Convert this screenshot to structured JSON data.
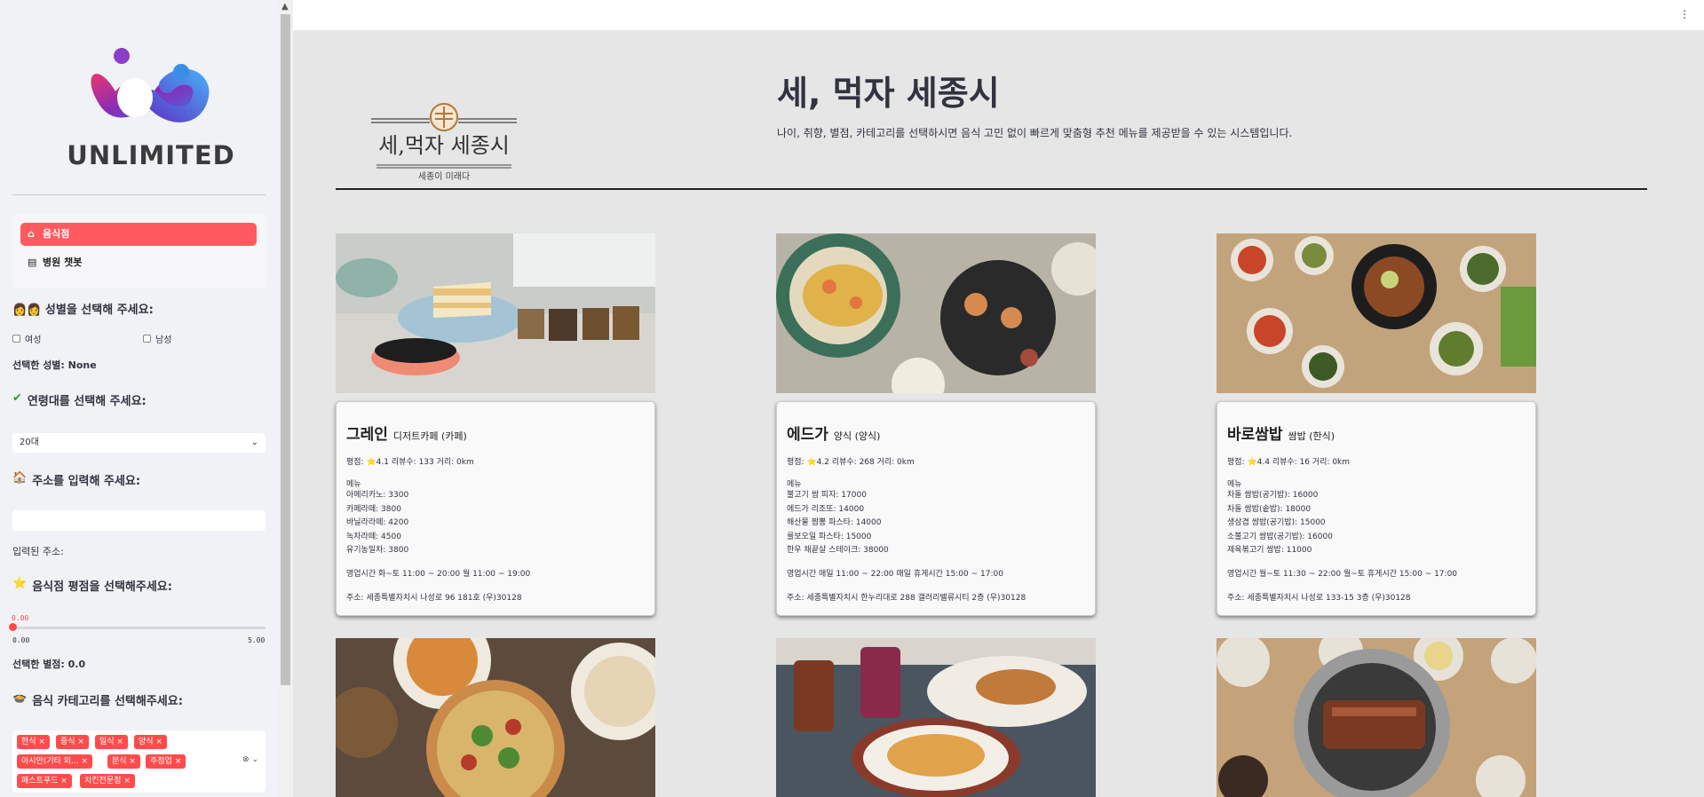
{
  "brand": {
    "name": "UNLIMITED"
  },
  "nav": {
    "items": [
      {
        "label": "음식점"
      },
      {
        "label": "병원 챗봇"
      }
    ]
  },
  "filters": {
    "gender": {
      "label": "👩‍👩 성별을 선택해 주세요:",
      "options": [
        "여성",
        "남성"
      ],
      "selected_text": "선택한 성별: None"
    },
    "age": {
      "label": "연령대를 선택해 주세요:",
      "value": "20대"
    },
    "address": {
      "label": "주소를 입력해 주세요:",
      "value": "",
      "entered_text": "입력된 주소:"
    },
    "rating": {
      "label": "음식점 평점을 선택해주세요:",
      "value": "0.00",
      "min": "0.00",
      "max": "5.00",
      "selected_text": "선택한 별점: 0.0"
    },
    "category": {
      "label": "음식 카테고리를 선택해주세요:",
      "tags": [
        "한식",
        "중식",
        "일식",
        "양식",
        "아시안(기타 외...",
        "분식",
        "주점업",
        "패스트푸드",
        "치킨전문점"
      ]
    }
  },
  "hero": {
    "logo_text": "세,먹자 세종시",
    "logo_subtext": "세종이 미래다",
    "title": "세, 먹자 세종시",
    "description": "나이, 취향, 별점, 카테고리를 선택하시면 음식 고민 없이 빠르게 맞춤형 추천 메뉴를 제공받을 수 있는 시스템입니다."
  },
  "restaurants": [
    {
      "name": "그레인",
      "category": "디저트카페 (카페)",
      "meta": "평점: ⭐4.1 리뷰수: 133 거리: 0km",
      "menu_header": "메뉴",
      "menu": [
        "아메리카노: 3300",
        "카페라떼: 3800",
        "바닐라라떼: 4200",
        "녹차라떼: 4500",
        "유기농밀차: 3800"
      ],
      "hours": "영업시간 화~토 11:00 ~ 20:00 월 11:00 ~ 19:00",
      "address": "주소: 세종특별자치시 나성로 96 181호 (우)30128"
    },
    {
      "name": "에드가",
      "category": "양식 (양식)",
      "meta": "평점: ⭐4.2 리뷰수: 268 거리: 0km",
      "menu_header": "메뉴",
      "menu": [
        "불고기 쌈 피자: 17000",
        "에드가 리조또: 14000",
        "해산물 짬뽕 파스타: 14000",
        "룰보오일 파스타: 15000",
        "한우 채끝살 스테이크: 38000"
      ],
      "hours": "영업시간 매일 11:00 ~ 22:00 매일 휴게시간 15:00 ~ 17:00",
      "address": "주소: 세종특별자치시 한누리대로 288 갤러리밸류시티 2층 (우)30128"
    },
    {
      "name": "바로쌈밥",
      "category": "쌈밥 (한식)",
      "meta": "평점: ⭐4.4 리뷰수: 16 거리: 0km",
      "menu_header": "메뉴",
      "menu": [
        "차돌 쌈밥(공기밥): 16000",
        "차돌 쌈밥(솥밥): 18000",
        "생삼겹 쌈밥(공기밥): 15000",
        "소불고기 쌈밥(공기밥): 16000",
        "제육볶고기 쌈밥: 11000"
      ],
      "hours": "영업시간 월~토 11:30 ~ 22:00 월~토 휴게시간 15:00 ~ 17:00",
      "address": "주소: 세종특별자치시 나성로 133-15 3층 (우)30128"
    }
  ]
}
